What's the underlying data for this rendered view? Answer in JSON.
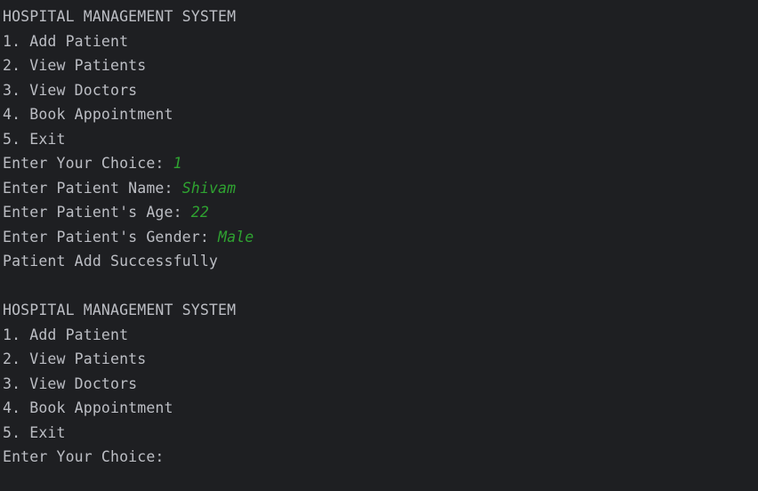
{
  "colors": {
    "background": "#1e1f22",
    "text": "#bcbec4",
    "user_input": "#2fa331"
  },
  "console": {
    "lines": [
      {
        "text": "HOSPITAL MANAGEMENT SYSTEM",
        "input": ""
      },
      {
        "text": "1. Add Patient",
        "input": ""
      },
      {
        "text": "2. View Patients",
        "input": ""
      },
      {
        "text": "3. View Doctors",
        "input": ""
      },
      {
        "text": "4. Book Appointment",
        "input": ""
      },
      {
        "text": "5. Exit",
        "input": ""
      },
      {
        "text": "Enter Your Choice: ",
        "input": "1"
      },
      {
        "text": "Enter Patient Name: ",
        "input": "Shivam"
      },
      {
        "text": "Enter Patient's Age: ",
        "input": "22"
      },
      {
        "text": "Enter Patient's Gender: ",
        "input": "Male"
      },
      {
        "text": "Patient Add Successfully",
        "input": ""
      },
      {
        "text": "",
        "input": ""
      },
      {
        "text": "HOSPITAL MANAGEMENT SYSTEM",
        "input": ""
      },
      {
        "text": "1. Add Patient",
        "input": ""
      },
      {
        "text": "2. View Patients",
        "input": ""
      },
      {
        "text": "3. View Doctors",
        "input": ""
      },
      {
        "text": "4. Book Appointment",
        "input": ""
      },
      {
        "text": "5. Exit",
        "input": ""
      },
      {
        "text": "Enter Your Choice: ",
        "input": ""
      }
    ]
  }
}
